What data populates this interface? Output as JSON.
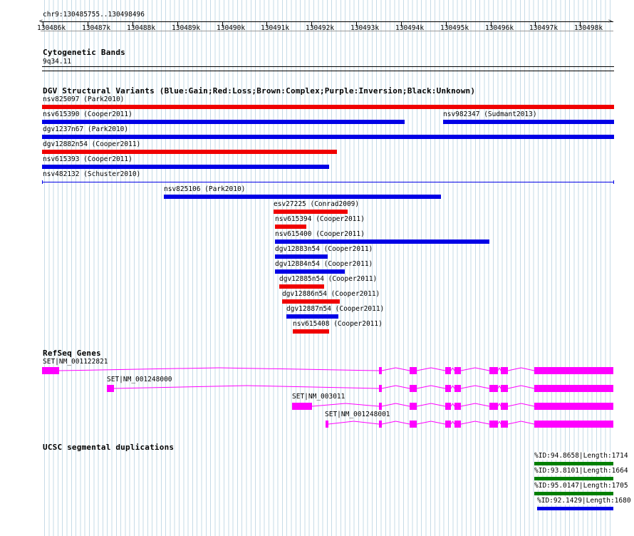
{
  "ruler": {
    "locus": "chr9:130485755..130498496",
    "ticks": [
      "130486k",
      "130487k",
      "130488k",
      "130489k",
      "130490k",
      "130491k",
      "130492k",
      "130493k",
      "130494k",
      "130495k",
      "130496k",
      "130497k",
      "130498k"
    ]
  },
  "cyto": {
    "title": "Cytogenetic Bands",
    "band": "9q34.11"
  },
  "dgv": {
    "title": "DGV Structural Variants (Blue:Gain;Red:Loss;Brown:Complex;Purple:Inversion;Black:Unknown)",
    "colors": {
      "gain": "#0000e6",
      "loss": "#f00000",
      "unknown": "#000000"
    },
    "items": [
      {
        "label": "nsv825097 (Park2010)",
        "type": "loss"
      },
      {
        "label": "nsv615390 (Cooper2011)",
        "type": "gain"
      },
      {
        "label": "nsv982347 (Sudmant2013)",
        "type": "gain"
      },
      {
        "label": "dgv1237n67 (Park2010)",
        "type": "gain"
      },
      {
        "label": "dgv12882n54 (Cooper2011)",
        "type": "loss"
      },
      {
        "label": "nsv615393 (Cooper2011)",
        "type": "gain"
      },
      {
        "label": "nsv482132 (Schuster2010)",
        "type": "unknown"
      },
      {
        "label": "nsv825106 (Park2010)",
        "type": "gain"
      },
      {
        "label": "esv27225 (Conrad2009)",
        "type": "loss"
      },
      {
        "label": "nsv615394 (Cooper2011)",
        "type": "loss"
      },
      {
        "label": "nsv615400 (Cooper2011)",
        "type": "gain"
      },
      {
        "label": "dgv12883n54 (Cooper2011)",
        "type": "gain"
      },
      {
        "label": "dgv12884n54 (Cooper2011)",
        "type": "gain"
      },
      {
        "label": "dgv12885n54 (Cooper2011)",
        "type": "loss"
      },
      {
        "label": "dgv12886n54 (Cooper2011)",
        "type": "loss"
      },
      {
        "label": "dgv12887n54 (Cooper2011)",
        "type": "gain"
      },
      {
        "label": "nsv615408 (Cooper2011)",
        "type": "loss"
      }
    ]
  },
  "refseq": {
    "title": "RefSeq Genes",
    "color": "#ff00ff",
    "genes": [
      {
        "label": "SET|NM_001122821"
      },
      {
        "label": "SET|NM_001248000"
      },
      {
        "label": "SET|NM_003011"
      },
      {
        "label": "SET|NM_001248001"
      }
    ]
  },
  "segdup": {
    "title": "UCSC segmental duplications",
    "items": [
      {
        "label": "%ID:94.8658|Length:1714",
        "color": "#007f00"
      },
      {
        "label": "%ID:93.8101|Length:1664",
        "color": "#007f00"
      },
      {
        "label": "%ID:95.0147|Length:1705",
        "color": "#007f00"
      },
      {
        "label": "%ID:92.1429|Length:1680",
        "color": "#0000e6"
      }
    ]
  }
}
